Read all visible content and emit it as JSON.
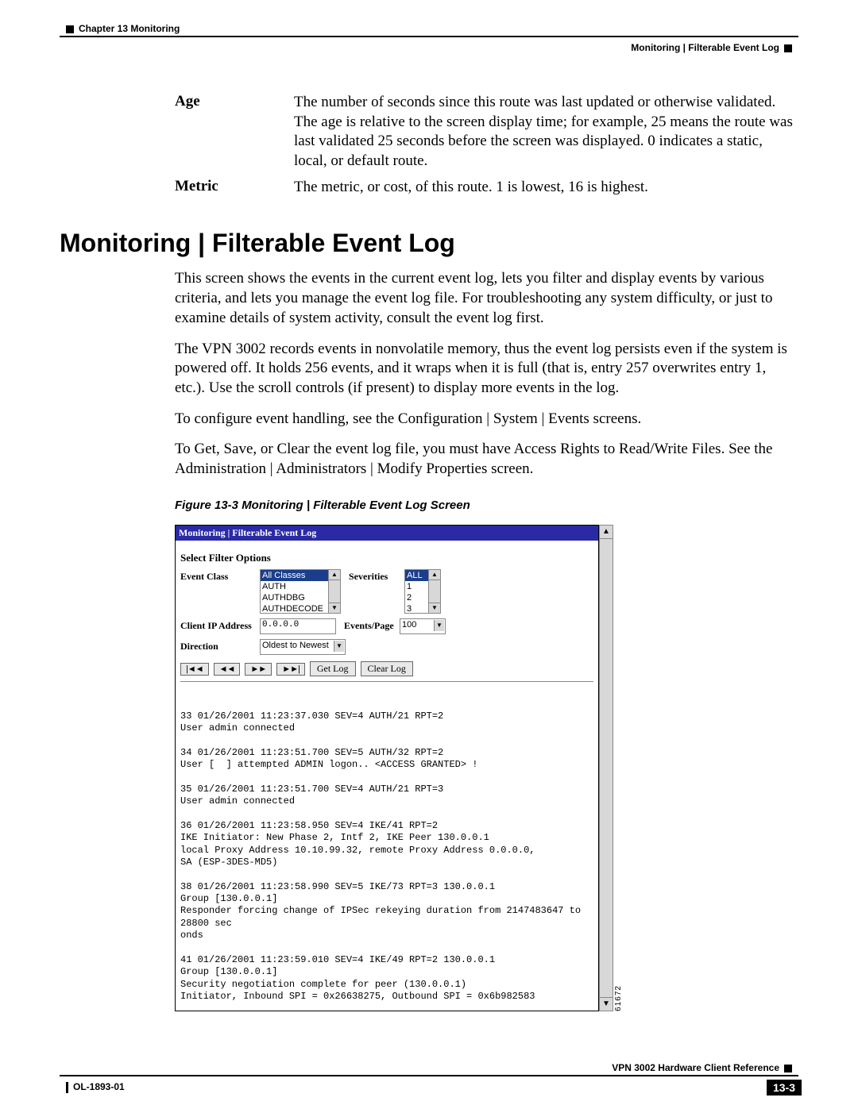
{
  "header": {
    "chapter": "Chapter 13    Monitoring",
    "breadcrumb": "Monitoring | Filterable Event Log"
  },
  "defs": {
    "age_term": "Age",
    "age_desc": "The number of seconds since this route was last updated or otherwise validated. The age is relative to the screen display time; for example, 25 means the route was last validated 25 seconds before the screen was displayed. 0 indicates a static, local, or default route.",
    "metric_term": "Metric",
    "metric_desc": "The metric, or cost, of this route. 1 is lowest, 16 is highest."
  },
  "section_title": "Monitoring | Filterable Event Log",
  "paras": {
    "p1": "This screen shows the events in the current event log, lets you filter and display events by various criteria, and lets you manage the event log file. For troubleshooting any system difficulty, or just to examine details of system activity, consult the event log first.",
    "p2": "The VPN 3002 records events in nonvolatile memory, thus the event log persists even if the system is powered off. It holds 256 events, and it wraps when it is full (that is, entry 257 overwrites entry 1, etc.). Use the scroll controls (if present) to display more events in the log.",
    "p3": "To configure event handling, see the Configuration | System | Events screens.",
    "p4": "To Get, Save, or Clear the event log file, you must have Access Rights to Read/Write Files. See the Administration | Administrators | Modify Properties screen."
  },
  "figure_caption": "Figure 13-3   Monitoring | Filterable Event Log Screen",
  "ss": {
    "title": "Monitoring | Filterable Event Log",
    "filter_heading": "Select Filter Options",
    "labels": {
      "event_class": "Event Class",
      "severities": "Severities",
      "client_ip": "Client IP Address",
      "events_page": "Events/Page",
      "direction": "Direction"
    },
    "event_class_options": [
      "All Classes",
      "AUTH",
      "AUTHDBG",
      "AUTHDECODE"
    ],
    "severity_options": [
      "ALL",
      "1",
      "2",
      "3"
    ],
    "client_ip_value": "0.0.0.0",
    "events_page_value": "100",
    "direction_value": "Oldest to Newest",
    "buttons": {
      "first": "|◄◄",
      "prev": "◄◄",
      "next": "►►",
      "last": "►►|",
      "get": "Get Log",
      "clear": "Clear Log"
    },
    "log": "33 01/26/2001 11:23:37.030 SEV=4 AUTH/21 RPT=2\nUser admin connected\n\n34 01/26/2001 11:23:51.700 SEV=5 AUTH/32 RPT=2\nUser [  ] attempted ADMIN logon.. <ACCESS GRANTED> !\n\n35 01/26/2001 11:23:51.700 SEV=4 AUTH/21 RPT=3\nUser admin connected\n\n36 01/26/2001 11:23:58.950 SEV=4 IKE/41 RPT=2\nIKE Initiator: New Phase 2, Intf 2, IKE Peer 130.0.0.1\nlocal Proxy Address 10.10.99.32, remote Proxy Address 0.0.0.0,\nSA (ESP-3DES-MD5)\n\n38 01/26/2001 11:23:58.990 SEV=5 IKE/73 RPT=3 130.0.0.1\nGroup [130.0.0.1]\nResponder forcing change of IPSec rekeying duration from 2147483647 to 28800 sec\nonds\n\n41 01/26/2001 11:23:59.010 SEV=4 IKE/49 RPT=2 130.0.0.1\nGroup [130.0.0.1]\nSecurity negotiation complete for peer (130.0.0.1)\nInitiator, Inbound SPI = 0x26638275, Outbound SPI = 0x6b982583",
    "image_id": "61672"
  },
  "footer": {
    "doc": "VPN 3002 Hardware Client Reference",
    "ol": "OL-1893-01",
    "page": "13-3"
  }
}
